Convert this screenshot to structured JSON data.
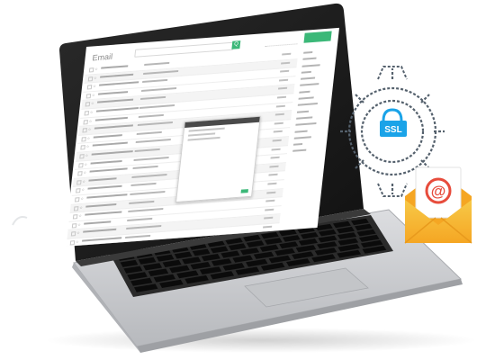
{
  "email_app": {
    "logo": "Email",
    "search_button": "Q",
    "compose_label": "",
    "row_count": 21
  },
  "badges": {
    "ssl_label": "SSL",
    "at_symbol": "@"
  },
  "colors": {
    "laptop_body": "#c9cbce",
    "laptop_dark": "#1c1c1c",
    "keys": "#0b0b0b",
    "gear": "#55616d",
    "ssl_blue": "#1aa3e8",
    "envelope_orange": "#f5a623",
    "envelope_yellow": "#f7c948",
    "at_red": "#e74c3c",
    "accent_green": "#3bb878"
  }
}
